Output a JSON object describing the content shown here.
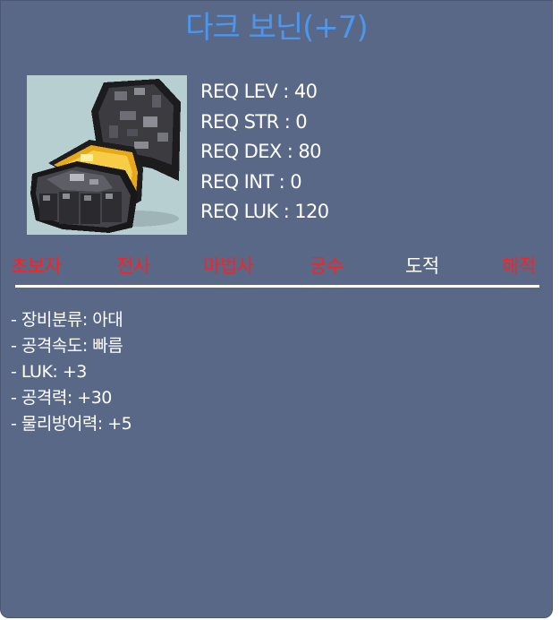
{
  "item": {
    "title": "다크 보닌(+7)"
  },
  "requirements": [
    "REQ LEV : 40",
    "REQ STR : 0",
    "REQ DEX : 80",
    "REQ INT : 0",
    "REQ LUK : 120"
  ],
  "jobs": [
    {
      "label": "초보자",
      "status": "unavailable",
      "color": "#ff1f1f"
    },
    {
      "label": "전사",
      "status": "unavailable",
      "color": "#ff1f1f"
    },
    {
      "label": "마법사",
      "status": "unavailable",
      "color": "#ff1f1f"
    },
    {
      "label": "궁수",
      "status": "unavailable",
      "color": "#ff1f1f"
    },
    {
      "label": "도적",
      "status": "available",
      "color": "#ffffff"
    },
    {
      "label": "해적",
      "status": "unavailable",
      "color": "#ff1f1f"
    }
  ],
  "stats": [
    "- 장비분류: 아대",
    "- 공격속도: 빠름",
    "- LUK: +3",
    "- 공격력: +30",
    "- 물리방어력: +5"
  ],
  "colors": {
    "panel": "#5a6888",
    "title": "#4b96ee",
    "icon_background": "#b8cfd2"
  },
  "icon": "dark-claw-glove-icon"
}
